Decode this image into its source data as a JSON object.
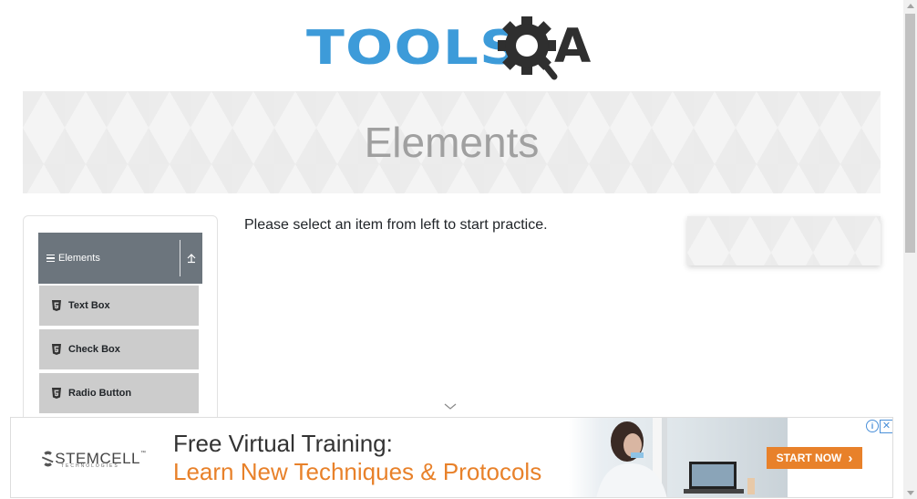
{
  "logo": {
    "tools_text": "TOOLS",
    "qa_text": "A"
  },
  "banner": {
    "title": "Elements"
  },
  "sidebar": {
    "group": {
      "label": "Elements"
    },
    "items": [
      {
        "label": "Text Box"
      },
      {
        "label": "Check Box"
      },
      {
        "label": "Radio Button"
      }
    ]
  },
  "main": {
    "instruction": "Please select an item from left to start practice."
  },
  "ad": {
    "brand": "STEMCELL",
    "brand_tm": "™",
    "brand_sub": "TECHNOLOGIES",
    "headline": "Free Virtual Training:",
    "subheadline": "Learn New Techniques & Protocols",
    "cta": "START NOW",
    "cta_icon": "›",
    "info_icon": "i",
    "close_icon": "✕"
  },
  "colors": {
    "logo_blue": "#3d9bd9",
    "logo_dark": "#2f2f2f",
    "group_header": "#6c757d",
    "menu_item": "#cccccc",
    "ad_orange": "#e8812a"
  }
}
